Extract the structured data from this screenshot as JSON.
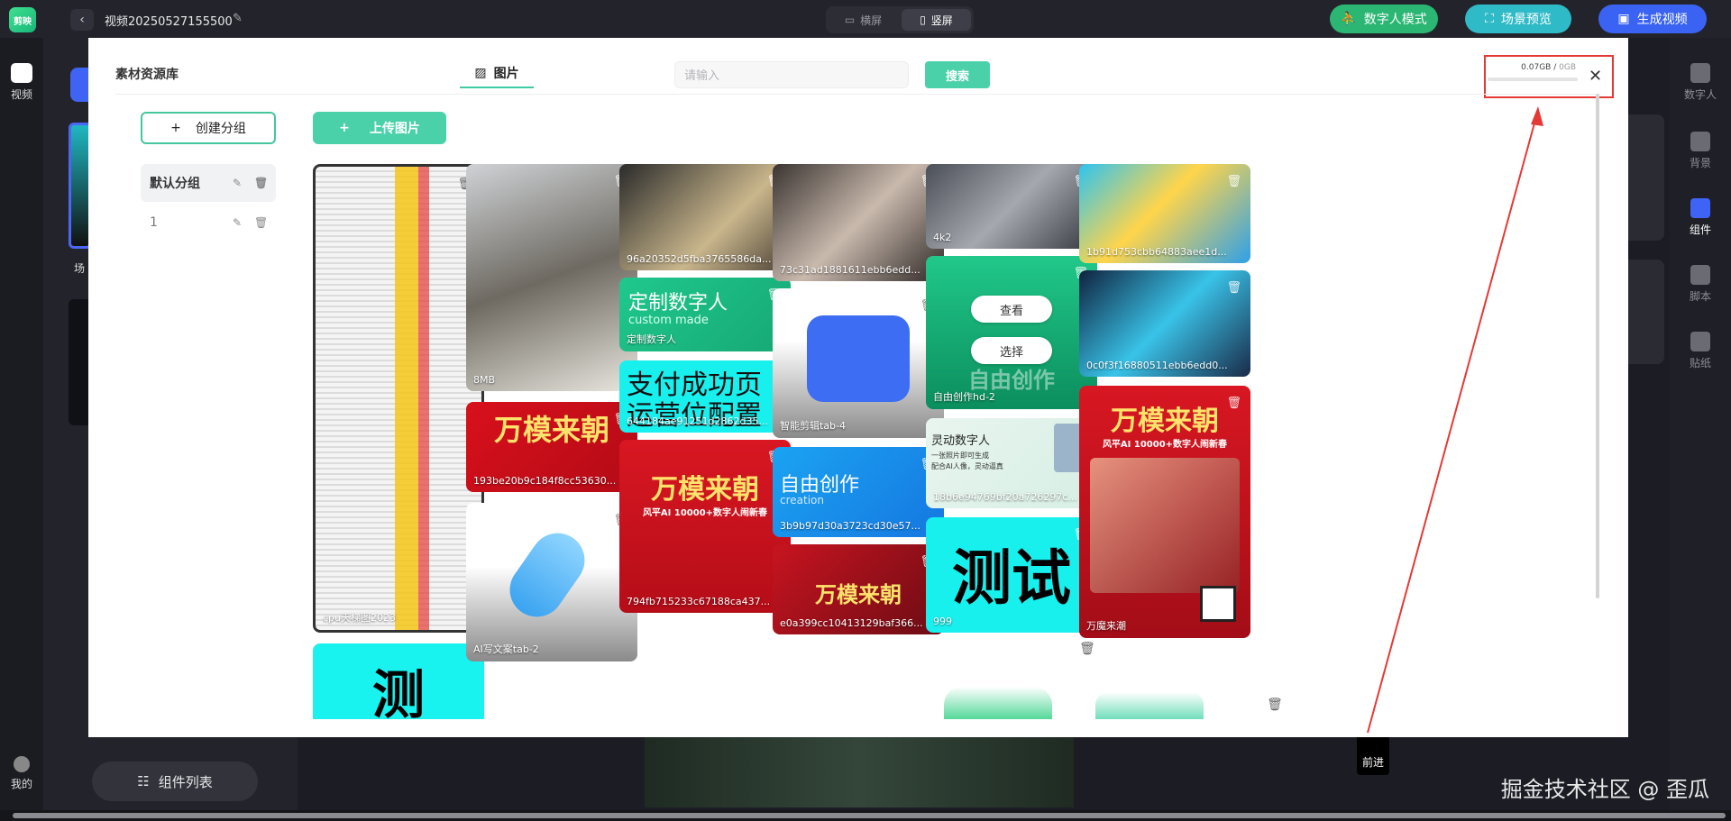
{
  "app": {
    "logo_text": "剪映",
    "project_title": "视频20250527155500",
    "orientation": {
      "landscape": "横屏",
      "portrait": "竖屏"
    },
    "buttons": {
      "digital_human": "数字人模式",
      "preview": "场景预览",
      "generate": "生成视频"
    }
  },
  "left_rail": {
    "video": "视频",
    "me": "我的"
  },
  "left_panel": {
    "scene_label": "场",
    "component_list": "组件列表"
  },
  "right_rail": {
    "items": [
      "数字人",
      "背景",
      "组件",
      "脚本",
      "贴纸"
    ]
  },
  "tooltip": {
    "forward": "前进"
  },
  "watermark": "掘金技术社区 @ 歪瓜",
  "modal": {
    "title": "素材资源库",
    "tab_images": "图片",
    "search_placeholder": "请输入",
    "search_button": "搜索",
    "storage_used": "0.07GB",
    "storage_total": "0GB",
    "storage_fraction": 0,
    "create_group": "创建分组",
    "upload_button": "上传图片",
    "groups": [
      {
        "label": "默认分组"
      },
      {
        "label": "1"
      }
    ],
    "card_actions": {
      "view": "查看",
      "select": "选择"
    },
    "cards": [
      "cpu天梯图2023",
      "8MB",
      "96a20352d5fba3765586da...",
      "73c31ad1881611ebb6edd...",
      "4k2",
      "1b91d753cbb64883aee1d...",
      "定制数字人",
      "智能剪辑tab-4",
      "自由创作hd-2",
      "0c0f3f16880511ebb6edd0...",
      "193be20b9c184f8cc53630...",
      "644184ae91251d2862d35...",
      "灵动数字人",
      "18b6e94769bf20a726297c...",
      "万魔来潮",
      "3b9b97d30a3723cd30e57...",
      "AI写文案tab-2",
      "794fb715233c67188ca437...",
      "e0a399cc10413129baf366...",
      "999"
    ],
    "card_texts": {
      "custom_title": "定制数字人",
      "custom_sub": "custom made",
      "pay_line1": "支付成功页",
      "pay_line2": "运营位配置",
      "free_title": "自由创作",
      "free_sub": "creation",
      "wanmo": "万模来朝",
      "wanmo_sub": "风平AI 10000+数字人闹新春",
      "test": "测试",
      "test_spaced": "测 试",
      "free_create_overlay": "自由创作",
      "lingdong_sub1": "一张照片即可生成",
      "lingdong_sub2": "配合AI人像，灵动逼真"
    }
  },
  "colors": {
    "accent_green": "#4bd1a9",
    "brand_blue": "#3a63f3",
    "cyan": "#2fbac7",
    "annotation_red": "#e53935"
  }
}
